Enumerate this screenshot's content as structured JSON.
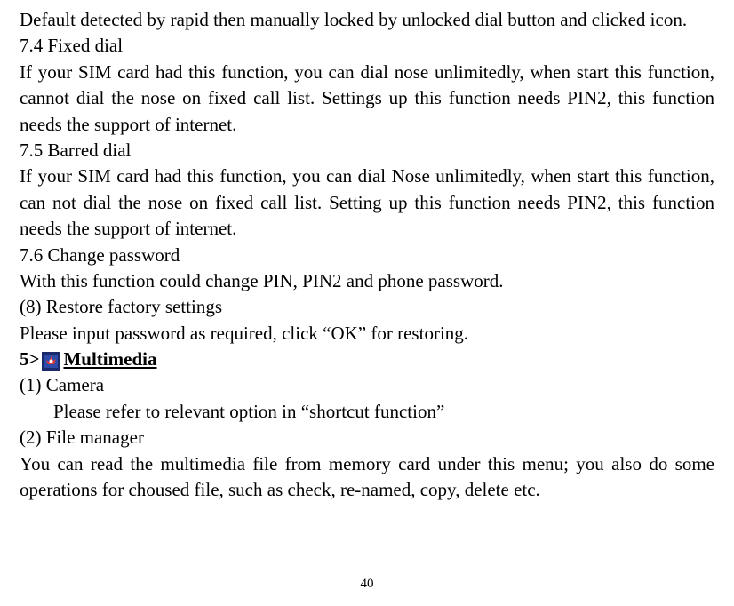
{
  "p1": "Default detected by rapid then manually locked by unlocked dial button and clicked icon.",
  "h74": "7.4 Fixed dial",
  "p74": "If your SIM card had this function, you can dial nose unlimitedly, when start this function, cannot dial the nose on fixed call list. Settings up this function needs PIN2, this function needs the support of internet.",
  "h75": "7.5 Barred dial",
  "p75": "If your SIM card had this function, you can dial Nose unlimitedly, when start this function, can not dial the nose on fixed call list. Setting up this function needs PIN2, this function needs the support of internet.",
  "h76": "7.6 Change password",
  "p76": "With this function could change PIN, PIN2 and phone password.",
  "h8": "(8) Restore factory settings",
  "p8": "Please input password as required, click “OK” for restoring.",
  "s5_prefix": "5>",
  "s5_label": "Multimedia",
  "h_cam": "(1) Camera",
  "p_cam": "Please refer to relevant option in “shortcut function”",
  "h_fm": "(2) File manager",
  "p_fm": "You can read the multimedia file from memory card under this menu; you also do some operations for choused file, such as check, re-named, copy, delete etc.",
  "page_number": "40"
}
